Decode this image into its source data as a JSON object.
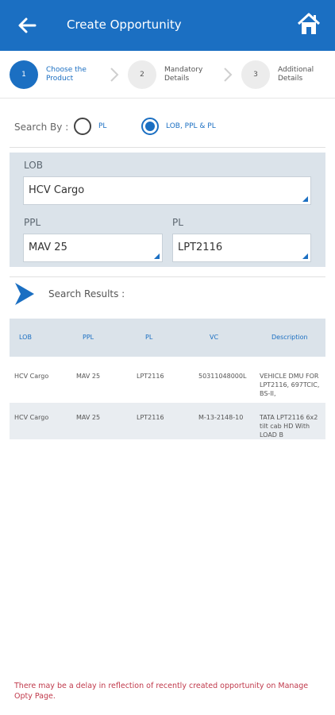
{
  "header": {
    "title": "Create Opportunity",
    "back_icon": "arrow-left-icon",
    "home_icon": "home-icon"
  },
  "stepper": {
    "steps": [
      {
        "number": "1",
        "label": "Choose the Product",
        "active": true
      },
      {
        "number": "2",
        "label": "Mandatory Details",
        "active": false
      },
      {
        "number": "3",
        "label": "Additional Details",
        "active": false
      }
    ]
  },
  "search_by": {
    "label": "Search By :",
    "options": [
      {
        "label": "PL",
        "selected": false
      },
      {
        "label": "LOB, PPL & PL",
        "selected": true
      }
    ]
  },
  "filters": {
    "lob_label": "LOB",
    "lob_value": "HCV Cargo",
    "ppl_label": "PPL",
    "ppl_value": "MAV 25",
    "pl_label": "PL",
    "pl_value": "LPT2116"
  },
  "results": {
    "heading": "Search Results :",
    "columns": [
      "LOB",
      "PPL",
      "PL",
      "VC",
      "Description"
    ],
    "rows": [
      [
        "HCV Cargo",
        "MAV 25",
        "LPT2116",
        "50311048000L",
        "VEHICLE DMU FOR LPT2116, 697TCIC, BS-II,"
      ],
      [
        "HCV Cargo",
        "MAV 25",
        "LPT2116",
        "M-13-2148-10",
        "TATA LPT2116 6x2 tilt cab HD With LOAD B"
      ]
    ]
  },
  "footer_note": "There may be a delay in reflection of recently created opportunity on Manage Opty Page.",
  "colors": {
    "primary": "#1b6fc2",
    "panel": "#dbe3ea",
    "warning_text": "#c0394b"
  }
}
